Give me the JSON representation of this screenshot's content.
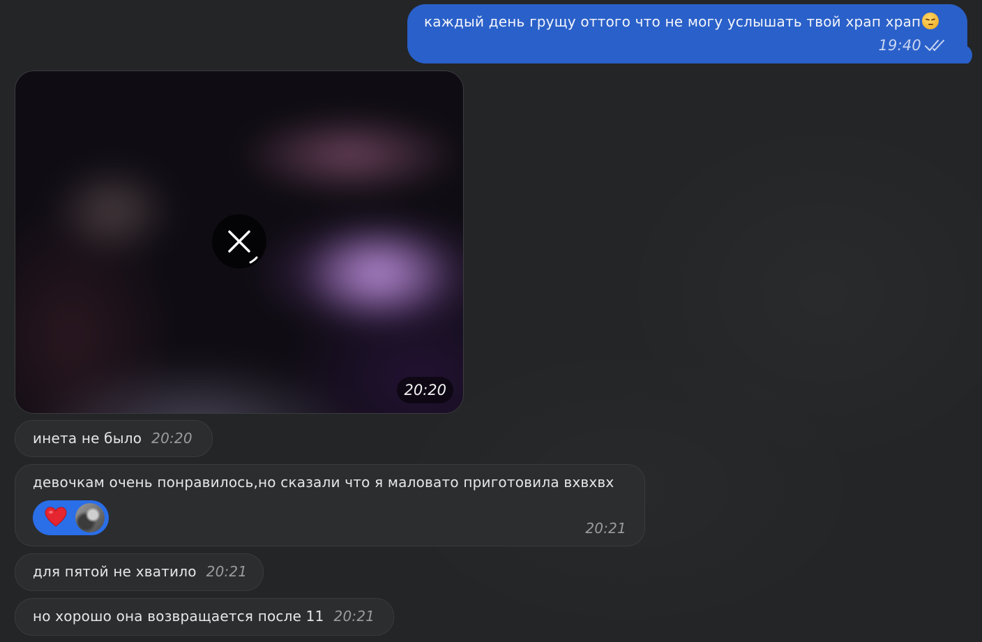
{
  "colors": {
    "background": "#232527",
    "outgoing_bubble": "#2a60c9",
    "incoming_bubble": "#2c2d2f",
    "reaction_pill": "#2a6ee8"
  },
  "messages": {
    "outgoing_1": {
      "text": "каждый день грущу оттого что не могу услышать твой храп храп",
      "emoji": "pensive-face",
      "time": "19:40",
      "status_icon": "double-check-icon"
    },
    "video_1": {
      "time": "20:20",
      "cancel_icon": "close-icon"
    },
    "incoming_1": {
      "text": "инета не было",
      "time": "20:20"
    },
    "incoming_2": {
      "text": "девочкам очень понравилось,но сказали что я маловато приготовила вхвхвх",
      "time": "20:21",
      "reaction": {
        "emoji": "red-heart",
        "avatar": "reactor-avatar"
      }
    },
    "incoming_3": {
      "text": "для пятой не хватило",
      "time": "20:21"
    },
    "incoming_4": {
      "text": "но хорошо она возвращается после 11",
      "time": "20:21"
    }
  }
}
